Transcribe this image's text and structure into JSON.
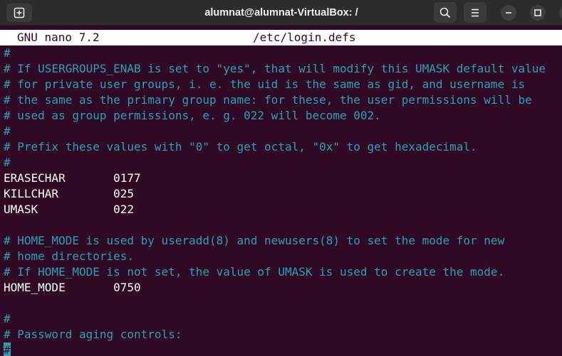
{
  "window": {
    "title": "alumnat@alumnat-VirtualBox: /"
  },
  "icons": {
    "new_tab": "new-tab-icon",
    "search": "search-icon",
    "menu": "hamburger-menu-icon",
    "minimize": "minimize-icon",
    "maximize": "maximize-icon",
    "close": "close-icon"
  },
  "nano": {
    "version": "GNU nano 7.2",
    "filename": "/etc/login.defs"
  },
  "colors": {
    "background": "#300a24",
    "comment": "#2aa1b3",
    "text": "#ffffff",
    "titlebar": "#2c2c2c"
  },
  "lines": [
    {
      "text": "#",
      "comment": true
    },
    {
      "text": "# If USERGROUPS_ENAB is set to \"yes\", that will modify this UMASK default value",
      "comment": true
    },
    {
      "text": "# for private user groups, i. e. the uid is the same as gid, and username is",
      "comment": true
    },
    {
      "text": "# the same as the primary group name: for these, the user permissions will be",
      "comment": true
    },
    {
      "text": "# used as group permissions, e. g. 022 will become 002.",
      "comment": true
    },
    {
      "text": "#",
      "comment": true
    },
    {
      "text": "# Prefix these values with \"0\" to get octal, \"0x\" to get hexadecimal.",
      "comment": true
    },
    {
      "text": "#",
      "comment": true
    },
    {
      "text": "ERASECHAR       0177",
      "comment": false
    },
    {
      "text": "KILLCHAR        025",
      "comment": false
    },
    {
      "text": "UMASK           022",
      "comment": false
    },
    {
      "text": "",
      "comment": false
    },
    {
      "text": "# HOME_MODE is used by useradd(8) and newusers(8) to set the mode for new",
      "comment": true
    },
    {
      "text": "# home directories.",
      "comment": true
    },
    {
      "text": "# If HOME_MODE is not set, the value of UMASK is used to create the mode.",
      "comment": true
    },
    {
      "text": "HOME_MODE       0750",
      "comment": false
    },
    {
      "text": "",
      "comment": false
    },
    {
      "text": "#",
      "comment": true
    },
    {
      "text": "# Password aging controls:",
      "comment": true
    },
    {
      "text": "#",
      "comment": true,
      "cursor": true
    }
  ]
}
